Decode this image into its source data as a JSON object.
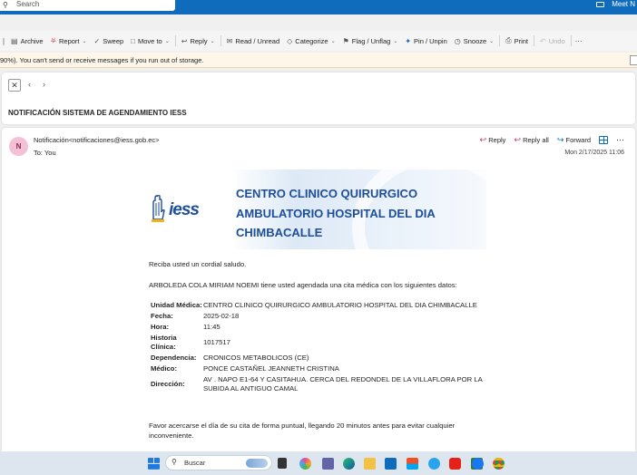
{
  "topbar": {
    "search_placeholder": "Search",
    "meet_label": "Meet N",
    "accent": "#0f6cbd"
  },
  "ribbon": {
    "archive": "Archive",
    "report": "Report",
    "sweep": "Sweep",
    "move_to": "Move to",
    "reply": "Reply",
    "read_unread": "Read / Unread",
    "categorize": "Categorize",
    "flag_unflag": "Flag / Unflag",
    "pin_unpin": "Pin / Unpin",
    "snooze": "Snooze",
    "print": "Print",
    "undo": "Undo"
  },
  "infobar": {
    "text": "90%).  You can't send or receive messages if you run out of storage."
  },
  "message": {
    "subject": "NOTIFICACIÓN SISTEMA DE AGENDAMIENTO IESS",
    "avatar_initial": "N",
    "from": "Notificación<notificaciones@iess.gob.ec>",
    "to": "To:  You",
    "actions": {
      "reply": "Reply",
      "reply_all": "Reply all",
      "forward": "Forward"
    },
    "date": "Mon 2/17/2025 11:06"
  },
  "banner": {
    "logo_text": "iess",
    "title_line1": "CENTRO CLINICO QUIRURGICO",
    "title_line2": "AMBULATORIO HOSPITAL DEL DIA",
    "title_line3": "CHIMBACALLE"
  },
  "body": {
    "greeting": "Reciba usted un cordial saludo.",
    "intro": "ARBOLEDA COLA MIRIAM NOEMI tiene usted agendada una cita médica con los siguientes datos:",
    "rows": [
      {
        "key": "Unidad Médica:",
        "value": "CENTRO CLINICO QUIRURGICO AMBULATORIO HOSPITAL DEL DIA CHIMBACALLE"
      },
      {
        "key": "Fecha:",
        "value": "2025-02-18"
      },
      {
        "key": "Hora:",
        "value": "11:45"
      },
      {
        "key": "Historia Clínica:",
        "value": "1017517"
      },
      {
        "key": "Dependencia:",
        "value": "CRONICOS METABOLICOS (CE)"
      },
      {
        "key": "Médico:",
        "value": "PONCE CASTAÑEL JEANNETH CRISTINA"
      },
      {
        "key": "Dirección:",
        "value": "AV . NAPO E1-64 Y CASITAHUA. CERCA DEL REDONDEL DE LA VILLAFLORA POR LA SUBIDA AL ANTIGUO CAMAL"
      }
    ],
    "closing": "Favor acercarse el día de su cita de forma puntual, llegando 20 minutos antes para evitar cualquier inconveniente."
  },
  "taskbar": {
    "search_label": "Buscar"
  }
}
